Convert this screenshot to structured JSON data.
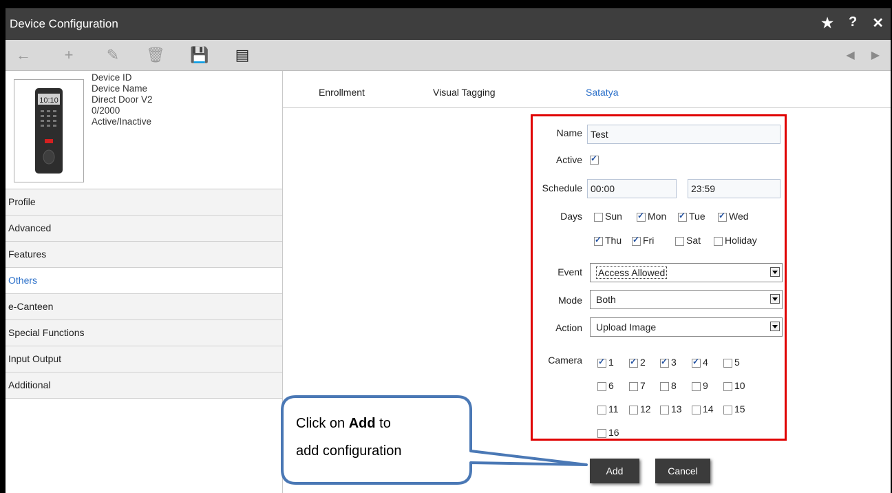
{
  "window": {
    "title": "Device Configuration"
  },
  "titlebar_icons": [
    "star-icon",
    "help-icon",
    "close-icon"
  ],
  "titlebar_glyphs": {
    "star": "★",
    "help": "?",
    "close": "✕"
  },
  "toolbar_glyphs": {
    "back": "←",
    "add": "+",
    "edit": "✎",
    "delete": "🗑",
    "save": "💾",
    "clear": "▤",
    "prev": "◀",
    "next": "▶"
  },
  "device": {
    "lines": [
      "Device ID",
      "Device Name",
      "Direct Door V2",
      "0/2000",
      "Active/Inactive"
    ],
    "screen_text": "10:10"
  },
  "menu": [
    {
      "label": "Profile"
    },
    {
      "label": "Advanced"
    },
    {
      "label": "Features"
    },
    {
      "label": "Others",
      "active": true
    },
    {
      "label": "e-Canteen"
    },
    {
      "label": "Special Functions"
    },
    {
      "label": "Input Output"
    },
    {
      "label": "Additional"
    }
  ],
  "tabs": [
    {
      "label": "Enrollment"
    },
    {
      "label": "Visual Tagging"
    },
    {
      "label": "Satatya",
      "active": true
    }
  ],
  "form": {
    "name_label": "Name",
    "name_value": "Test",
    "active_label": "Active",
    "active_checked": true,
    "schedule_label": "Schedule",
    "schedule_start": "00:00",
    "schedule_end": "23:59",
    "days_label": "Days",
    "days": {
      "sun": "Sun",
      "mon": "Mon",
      "tue": "Tue",
      "wed": "Wed",
      "thu": "Thu",
      "fri": "Fri",
      "sat": "Sat",
      "holiday": "Holiday"
    },
    "event_label": "Event",
    "event_value": "Access Allowed",
    "mode_label": "Mode",
    "mode_value": "Both",
    "action_label": "Action",
    "action_value": "Upload Image",
    "camera_label": "Camera",
    "cameras": [
      "1",
      "2",
      "3",
      "4",
      "5",
      "6",
      "7",
      "8",
      "9",
      "10",
      "11",
      "12",
      "13",
      "14",
      "15",
      "16"
    ]
  },
  "buttons": {
    "add": "Add",
    "cancel": "Cancel"
  },
  "callout": {
    "pre": "Click on ",
    "bold": "Add",
    "post": " to",
    "line2": "add configuration"
  },
  "colors": {
    "accent": "#2a6fc9",
    "highlight_border": "#e00000",
    "titlebar": "#3e3e3e",
    "callout_border": "#4a78b5"
  }
}
